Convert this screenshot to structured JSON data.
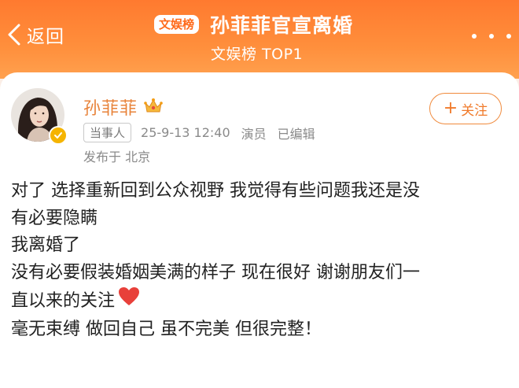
{
  "header": {
    "back_label": "返回",
    "badge": "文娱榜",
    "title": "孙菲菲官宣离婚",
    "subtitle": "文娱榜 TOP1"
  },
  "post": {
    "author": "孙菲菲",
    "role_tag": "当事人",
    "timestamp": "25-9-13 12:40",
    "profession": "演员",
    "edited": "已编辑",
    "location": "发布于 北京",
    "follow_label": "关注",
    "lines": [
      "对了 选择重新回到公众视野 我觉得有些问题我还是没",
      "有必要隐瞒",
      "我离婚了",
      "没有必要假装婚姻美满的样子 现在很好 谢谢朋友们一",
      "直以来的关注",
      "毫无束缚 做回自己 虽不完美 但很完整！"
    ]
  },
  "colors": {
    "header_orange": "#ff7a2f",
    "username": "#e8833a",
    "follow": "#f07a2a",
    "heart": "#e8403a"
  }
}
